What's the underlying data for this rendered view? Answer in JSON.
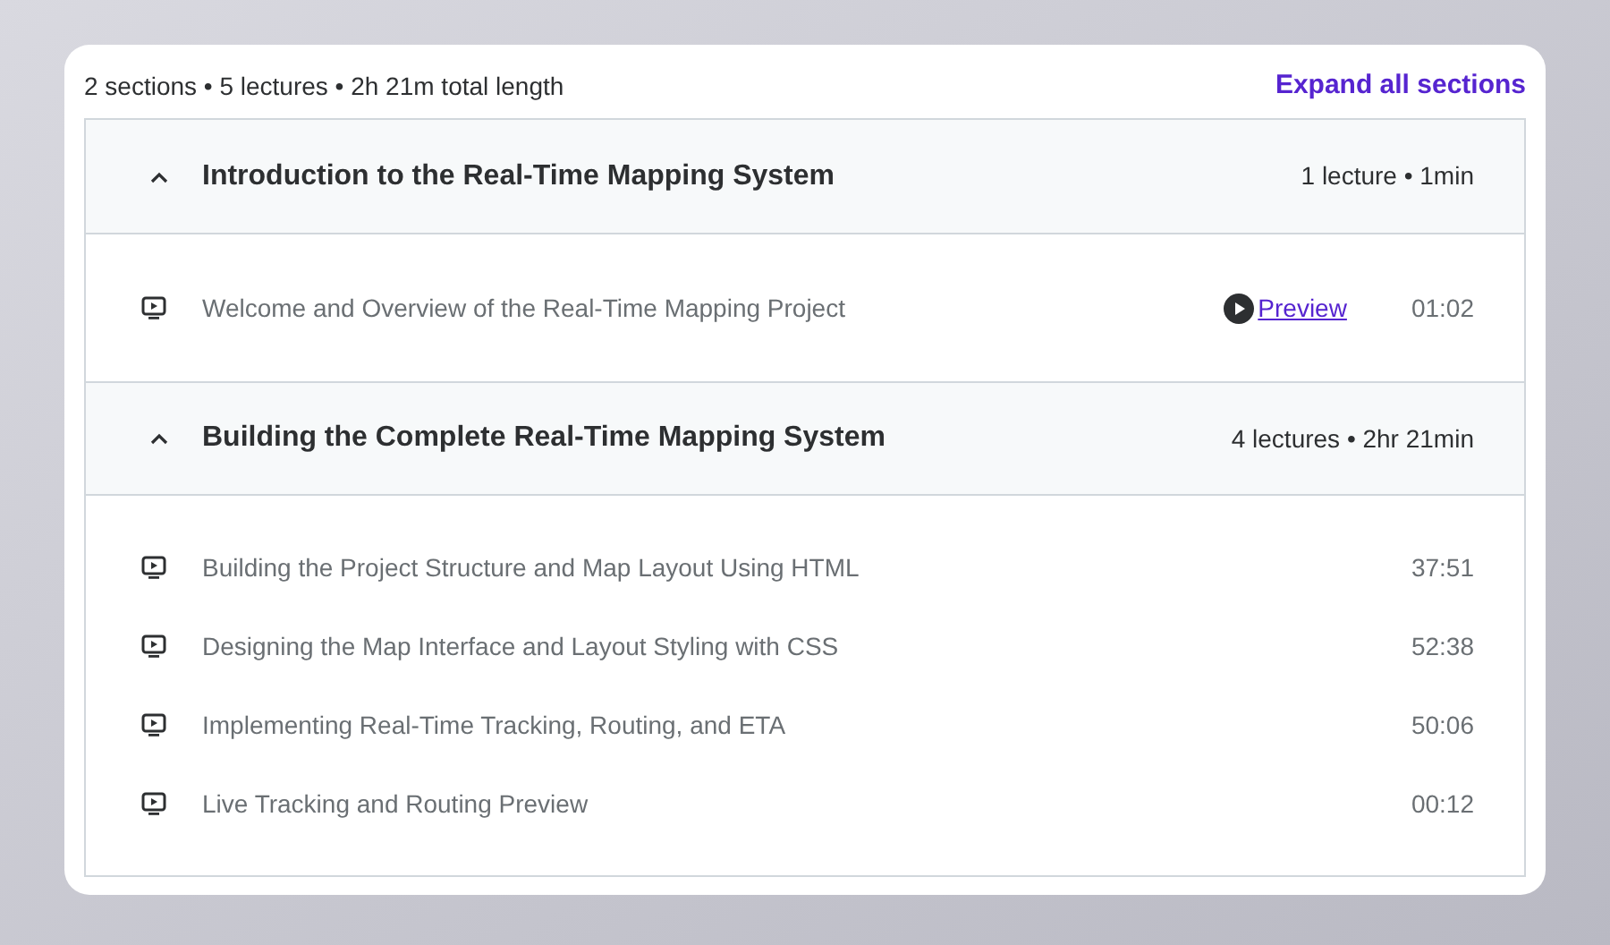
{
  "summary": "2 sections • 5 lectures • 2h 21m total length",
  "expand_all": "Expand all sections",
  "sections": [
    {
      "title": "Introduction to the Real-Time Mapping System",
      "meta": "1 lecture • 1min",
      "expanded": true,
      "lectures": [
        {
          "title": "Welcome and Overview of the Real-Time Mapping Project",
          "preview": "Preview",
          "duration": "01:02"
        }
      ]
    },
    {
      "title": "Building the Complete Real-Time Mapping System",
      "meta": "4 lectures • 2hr 21min",
      "expanded": true,
      "lectures": [
        {
          "title": "Building the Project Structure and Map Layout Using HTML",
          "duration": "37:51"
        },
        {
          "title": "Designing the Map Interface and Layout Styling with CSS",
          "duration": "52:38"
        },
        {
          "title": "Implementing Real-Time Tracking, Routing, and ETA",
          "duration": "50:06"
        },
        {
          "title": "Live Tracking and Routing Preview",
          "duration": "00:12"
        }
      ]
    }
  ]
}
